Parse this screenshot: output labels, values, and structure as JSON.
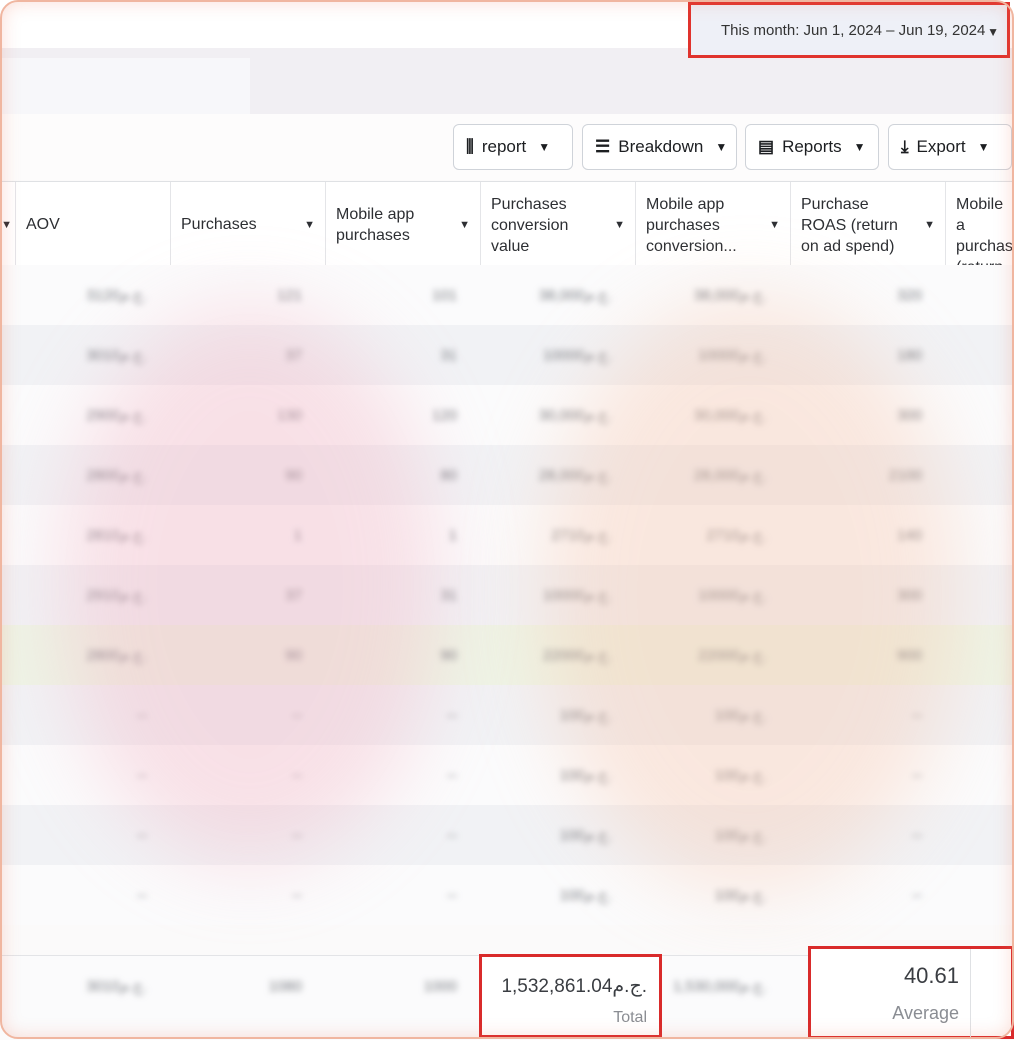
{
  "date_range": {
    "label": "This month: Jun 1, 2024 – Jun 19, 2024",
    "caret_icon": "caret-down-icon"
  },
  "toolbar": {
    "columns_label": "report",
    "breakdown_label": "Breakdown",
    "reports_label": "Reports",
    "export_label": "Export"
  },
  "columns": [
    {
      "label": "AOV"
    },
    {
      "label": "Purchases"
    },
    {
      "label": "Mobile app purchases"
    },
    {
      "label": "Purchases conversion value"
    },
    {
      "label": "Mobile app purchases conversion..."
    },
    {
      "label": "Purchase ROAS (return on ad spend)"
    },
    {
      "label": "Mobile a purchas (return o"
    }
  ],
  "rows": [
    [
      "3120ج.م.",
      "121",
      "101",
      "38,000ج.م.",
      "38,000ج.م.",
      "320"
    ],
    [
      "3010ج.م.",
      "37",
      "31",
      "10000ج.م.",
      "10000ج.م.",
      "180"
    ],
    [
      "2900ج.م.",
      "130",
      "120",
      "30,000ج.م.",
      "30,000ج.م.",
      "300"
    ],
    [
      "2800ج.م.",
      "90",
      "80",
      "28,000ج.م.",
      "28,000ج.م.",
      "2100"
    ],
    [
      "2810ج.م.",
      "1",
      "1",
      "2710ج.م.",
      "2710ج.م.",
      "140"
    ],
    [
      "2910ج.م.",
      "37",
      "31",
      "10000ج.م.",
      "10000ج.م.",
      "300"
    ],
    [
      "2800ج.م.",
      "90",
      "90",
      "22000ج.م.",
      "22000ج.م.",
      "900"
    ],
    [
      "--",
      "--",
      "--",
      "100ج.م.",
      "100ج.م.",
      "--"
    ],
    [
      "--",
      "--",
      "--",
      "100ج.م.",
      "100ج.م.",
      "--"
    ],
    [
      "--",
      "--",
      "--",
      "100ج.م.",
      "100ج.م.",
      "--"
    ],
    [
      "--",
      "--",
      "--",
      "100ج.م.",
      "100ج.م.",
      "--"
    ]
  ],
  "footer": {
    "aov": "3010ج.م.",
    "purchases": "1080",
    "mobile_purchases": "1000",
    "total_value": "1,532,861.04ج.م.",
    "total_label": "Total",
    "mobile_value": "1,530,000ج.م.",
    "roas_value": "40.61",
    "roas_label": "Average"
  },
  "colors": {
    "highlight": "#d92b2b",
    "border": "#dfe1e4"
  }
}
